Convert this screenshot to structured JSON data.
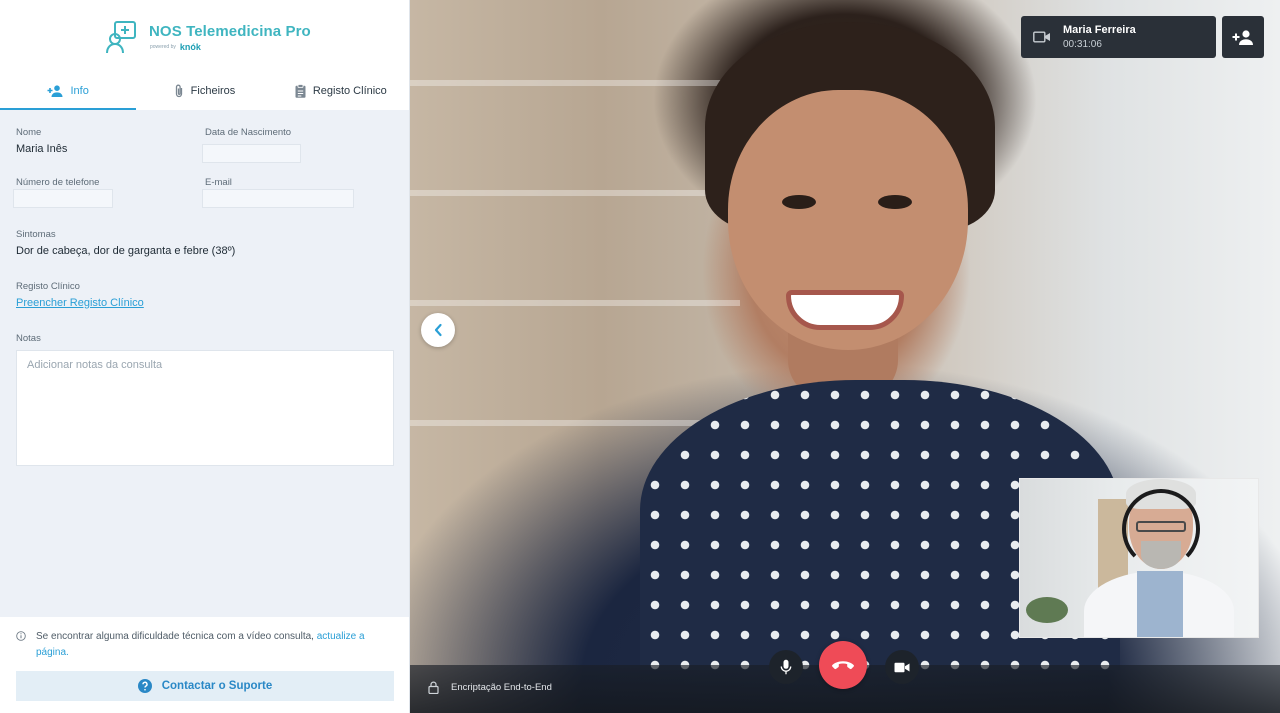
{
  "brand": {
    "title": "NOS Telemedicina Pro",
    "powered_by": "powered by",
    "provider": "knók"
  },
  "tabs": [
    {
      "label": "Info",
      "icon": "add-person-icon",
      "active": true
    },
    {
      "label": "Ficheiros",
      "icon": "paperclip-icon",
      "active": false
    },
    {
      "label": "Registo Clínico",
      "icon": "clipboard-icon",
      "active": false
    }
  ],
  "patient": {
    "name_label": "Nome",
    "name_value": "Maria Inês",
    "dob_label": "Data de Nascimento",
    "dob_value": "",
    "phone_label": "Número de telefone",
    "phone_value": "",
    "email_label": "E-mail",
    "email_value": "",
    "symptoms_label": "Sintomas",
    "symptoms_value": "Dor de cabeça, dor de garganta e febre (38º)",
    "record_label": "Registo Clínico",
    "record_link": "Preencher Registo Clínico",
    "notes_label": "Notas",
    "notes_placeholder": "Adicionar notas da consulta",
    "notes_value": ""
  },
  "footer": {
    "message": "Se encontrar alguma dificuldade técnica com a vídeo consulta,",
    "refresh_link": "actualize a página.",
    "support_button": "Contactar o Suporte"
  },
  "call": {
    "participant_name": "Maria Ferreira",
    "duration": "00:31:06",
    "encryption": "Encriptação End-to-End"
  },
  "colors": {
    "accent": "#2a9fd6",
    "brand": "#3fb5c0",
    "hangup": "#ef4b57"
  }
}
